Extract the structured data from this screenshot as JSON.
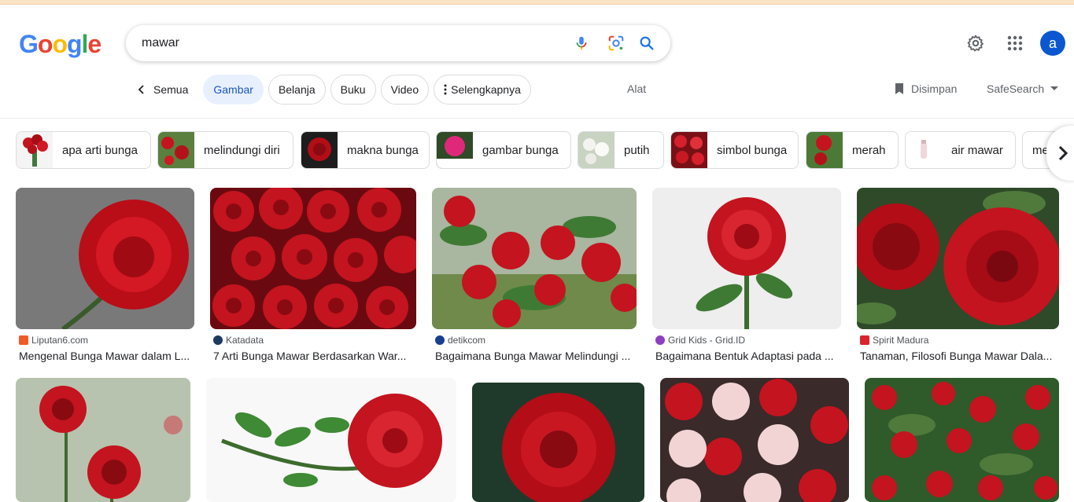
{
  "search": {
    "query": "mawar"
  },
  "header": {
    "avatar_letter": "a"
  },
  "tabs": [
    {
      "label": "Semua"
    },
    {
      "label": "Gambar"
    },
    {
      "label": "Belanja"
    },
    {
      "label": "Buku"
    },
    {
      "label": "Video"
    },
    {
      "label": "Selengkapnya"
    }
  ],
  "tools": {
    "alat": "Alat",
    "saved": "Disimpan",
    "safesearch": "SafeSearch"
  },
  "chips": [
    {
      "label": "apa arti bunga"
    },
    {
      "label": "melindungi diri"
    },
    {
      "label": "makna bunga"
    },
    {
      "label": "gambar bunga"
    },
    {
      "label": "putih"
    },
    {
      "label": "simbol bunga"
    },
    {
      "label": "merah"
    },
    {
      "label": "air mawar"
    },
    {
      "label": "me"
    }
  ],
  "results": [
    {
      "source": "Liputan6.com",
      "title": "Mengenal Bunga Mawar dalam L..."
    },
    {
      "source": "Katadata",
      "title": "7 Arti Bunga Mawar Berdasarkan War..."
    },
    {
      "source": "detikcom",
      "title": "Bagaimana Bunga Mawar Melindungi ..."
    },
    {
      "source": "Grid Kids - Grid.ID",
      "title": "Bagaimana Bentuk Adaptasi pada ..."
    },
    {
      "source": "Spirit Madura",
      "title": "Tanaman, Filosofi Bunga Mawar Dala..."
    }
  ],
  "colors": {
    "accent": "#1a56c4",
    "tab_active_bg": "#e8f0fe",
    "avatar": "#0b57d0",
    "rose": "#c4141f"
  },
  "icons": [
    "google-logo",
    "mic-icon",
    "lens-icon",
    "search-icon",
    "gear-icon",
    "apps-grid-icon",
    "chevron-left-icon",
    "more-vert-icon",
    "bookmark-icon",
    "caret-down-icon",
    "chevron-right-icon"
  ]
}
